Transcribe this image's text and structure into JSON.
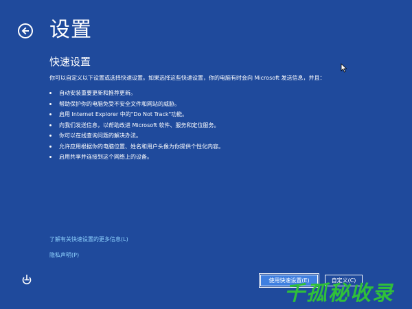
{
  "header": {
    "title": "设置",
    "back_icon": "back-arrow-icon"
  },
  "section": {
    "title": "快速设置",
    "intro": "你可以自定义以下设置或选择快速设置。如果选择这些快速设置，你的电脑有时会向 Microsoft 发送信息，并且："
  },
  "bullets": [
    "自动安装重要更新和推荐更新。",
    "帮助保护你的电脑免受不安全文件和网站的威胁。",
    "启用 Internet Explorer 中的\"Do Not Track\"功能。",
    "向我们发送信息，以帮助改进 Microsoft 软件、服务和定位服务。",
    "你可以在线查询问题的解决办法。",
    "允许应用根据你的电脑位置、姓名和用户头像为你提供个性化内容。",
    "启用共享并连接到这个网络上的设备。"
  ],
  "links": {
    "more_info": "了解有关快速设置的更多信息(L)",
    "privacy": "隐私声明(P)"
  },
  "buttons": {
    "express": "使用快速设置(E)",
    "custom": "自定义(C)"
  },
  "footer": {
    "accessibility_icon": "ease-of-access-icon"
  },
  "watermark": "千孤秘收录",
  "colors": {
    "background": "#1f4a9c",
    "link": "#8fd3ff",
    "primary_button": "#3f7fe0",
    "watermark": "#2fbf3a"
  }
}
